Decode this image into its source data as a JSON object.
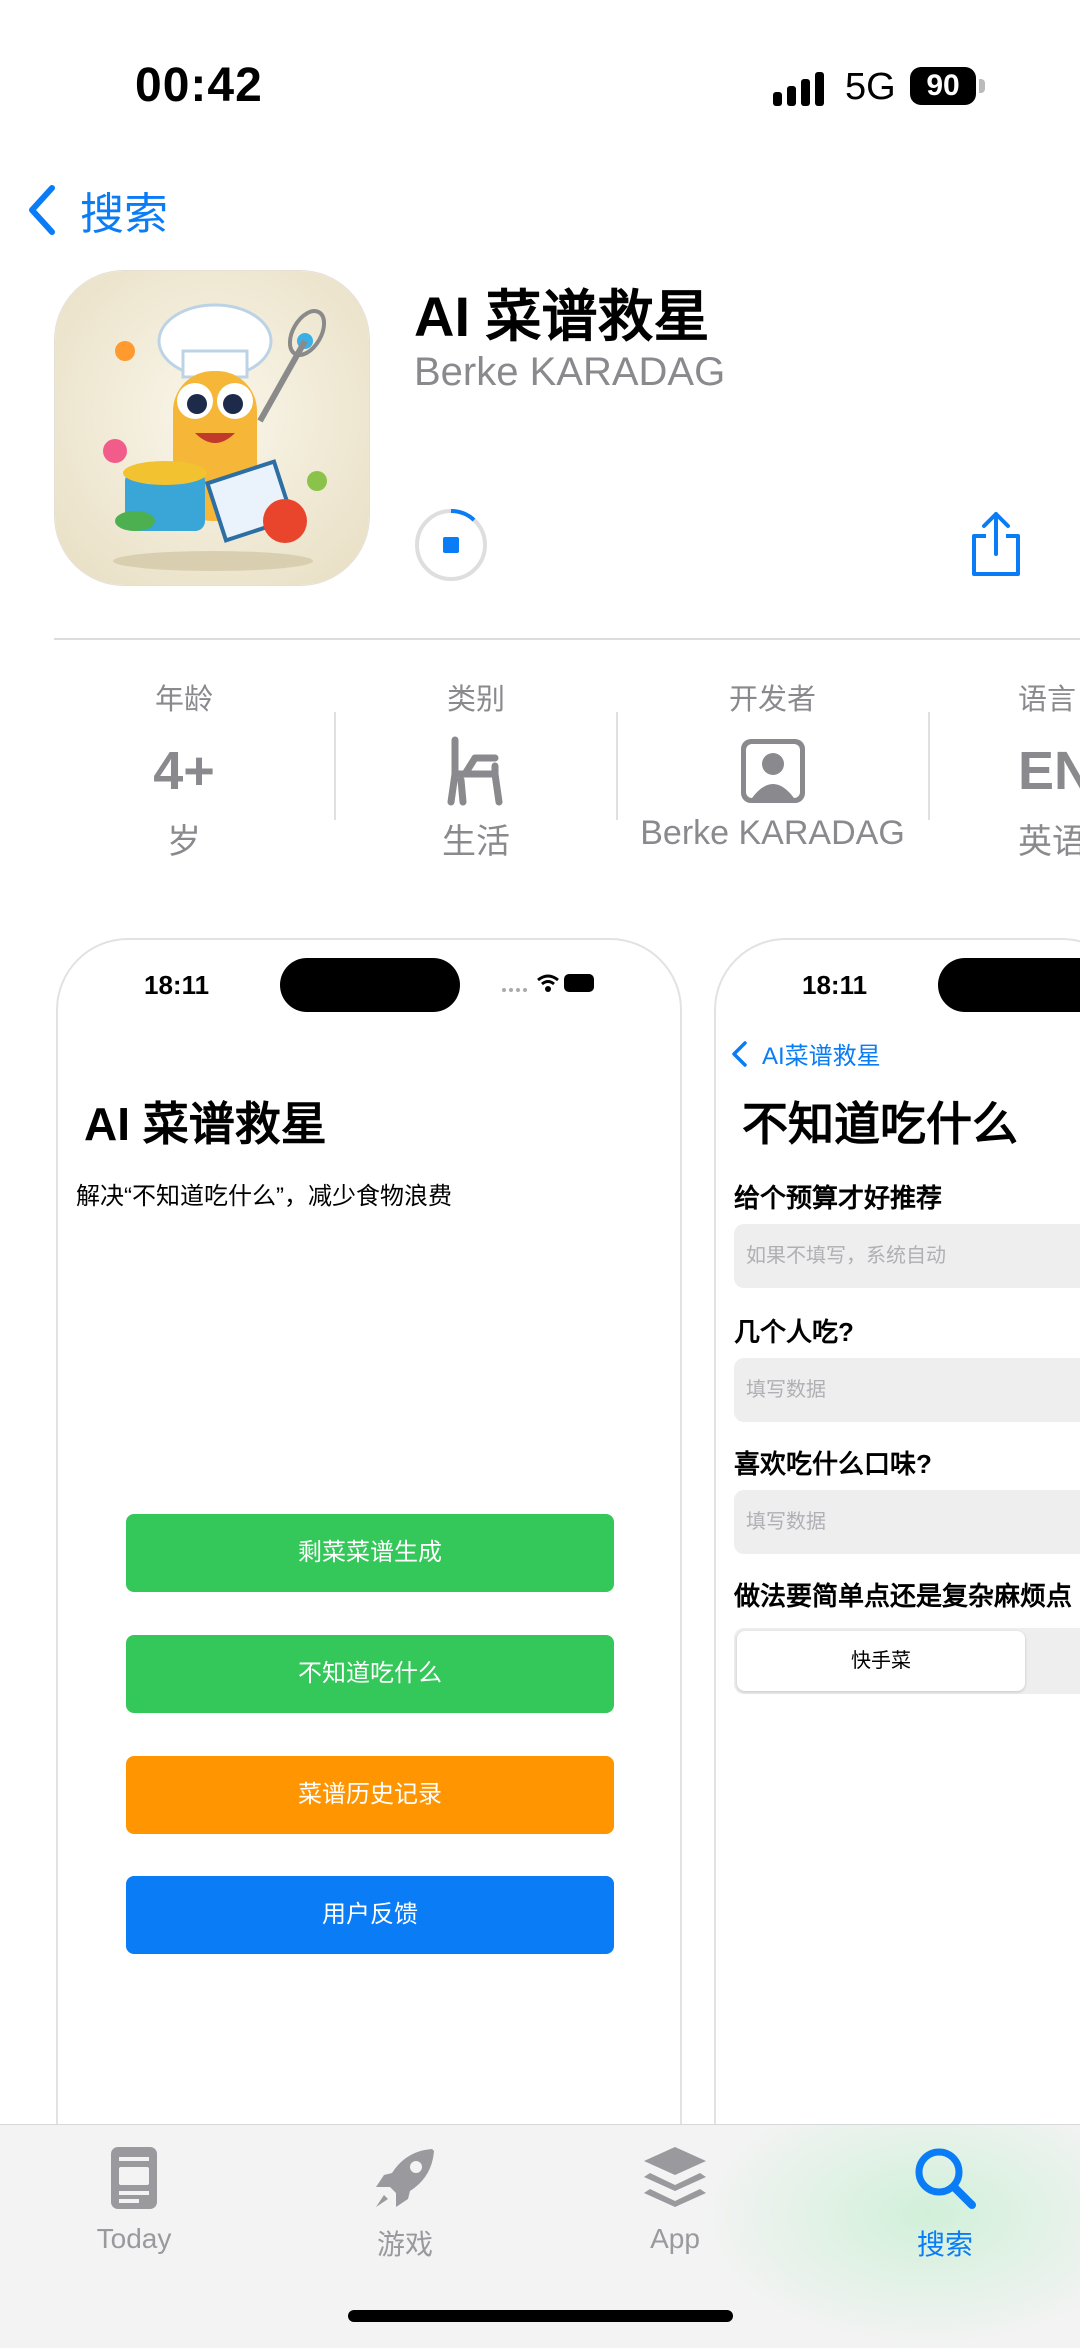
{
  "status_bar": {
    "time": "00:42",
    "network": "5G",
    "battery": "90"
  },
  "nav": {
    "back_label": "搜索"
  },
  "app": {
    "title": "AI 菜谱救星",
    "developer": "Berke KARADAG"
  },
  "info": [
    {
      "label": "年龄",
      "value": "4+",
      "sub": "岁"
    },
    {
      "label": "类别",
      "icon": "chair-icon",
      "sub": "生活"
    },
    {
      "label": "开发者",
      "icon": "developer-icon",
      "sub": "Berke KARADAG"
    },
    {
      "label": "语言",
      "value": "EN",
      "sub": "英语"
    }
  ],
  "screenshot1": {
    "time": "18:11",
    "title": "AI 菜谱救星",
    "description": "解决“不知道吃什么”，减少食物浪费",
    "buttons": [
      {
        "label": "剩菜菜谱生成",
        "color": "#34c759"
      },
      {
        "label": "不知道吃什么",
        "color": "#34c759"
      },
      {
        "label": "菜谱历史记录",
        "color": "#ff9500"
      },
      {
        "label": "用户反馈",
        "color": "#0a7cf6"
      }
    ]
  },
  "screenshot2": {
    "time": "18:11",
    "back_label": "AI菜谱救星",
    "title": "不知道吃什么",
    "questions": [
      {
        "label": "给个预算才好推荐",
        "placeholder": "如果不填写，系统自动"
      },
      {
        "label": "几个人吃?",
        "placeholder": "填写数据"
      },
      {
        "label": "喜欢吃什么口味?",
        "placeholder": "填写数据"
      },
      {
        "label": "做法要简单点还是复杂麻烦点"
      }
    ],
    "segment_selected": "快手菜"
  },
  "tabbar": {
    "tabs": [
      {
        "label": "Today",
        "icon": "today-icon"
      },
      {
        "label": "游戏",
        "icon": "rocket-icon"
      },
      {
        "label": "App",
        "icon": "layers-icon"
      },
      {
        "label": "搜索",
        "icon": "search-icon",
        "active": true
      }
    ]
  },
  "colors": {
    "accent": "#0a7cf6",
    "secondary_text": "#8a8a8e"
  }
}
